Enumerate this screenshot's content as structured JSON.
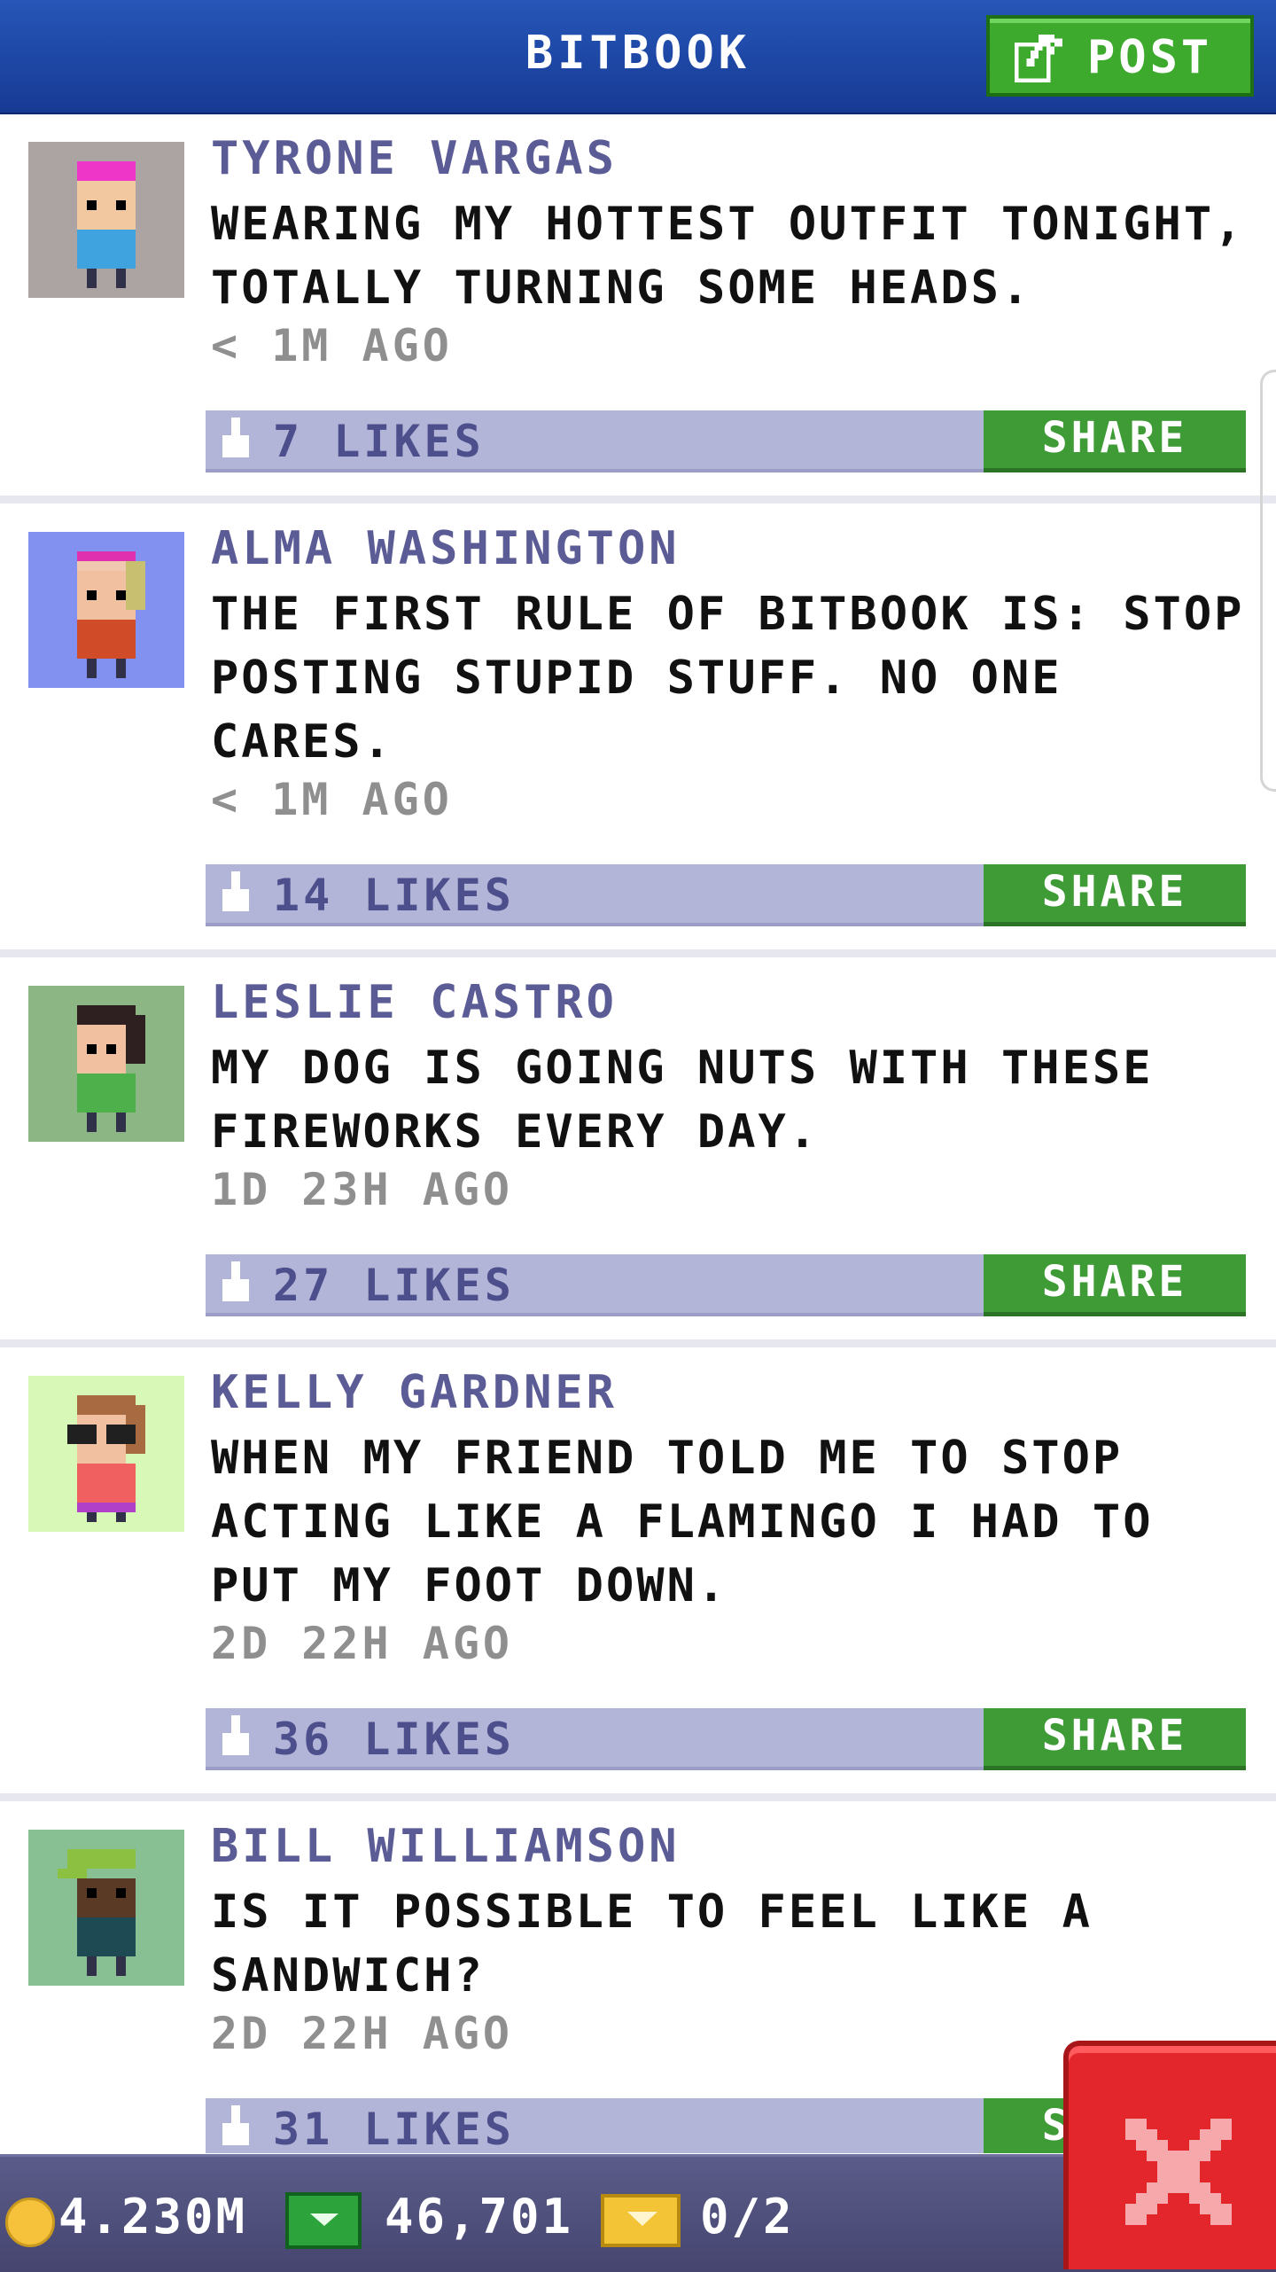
{
  "header": {
    "title": "BITBOOK",
    "post_label": "POST"
  },
  "posts": [
    {
      "author": "TYRONE VARGAS",
      "message": "WEARING MY HOTTEST OUTFIT TONIGHT, TOTALLY TURNING SOME HEADS.",
      "time": "< 1M AGO",
      "likes": "7 LIKES",
      "share": "SHARE"
    },
    {
      "author": "ALMA WASHINGTON",
      "message": "THE FIRST RULE OF BITBOOK IS: STOP POSTING STUPID STUFF. NO ONE CARES.",
      "time": "< 1M AGO",
      "likes": "14 LIKES",
      "share": "SHARE"
    },
    {
      "author": "LESLIE CASTRO",
      "message": "MY DOG IS GOING NUTS WITH THESE FIREWORKS EVERY DAY.",
      "time": "1D 23H AGO",
      "likes": "27 LIKES",
      "share": "SHARE"
    },
    {
      "author": "KELLY GARDNER",
      "message": "WHEN MY FRIEND TOLD ME TO STOP ACTING LIKE A FLAMINGO I HAD TO PUT MY FOOT DOWN.",
      "time": "2D 22H AGO",
      "likes": "36 LIKES",
      "share": "SHARE"
    },
    {
      "author": "BILL WILLIAMSON",
      "message": "IS IT POSSIBLE TO FEEL LIKE A SANDWICH?",
      "time": "2D 22H AGO",
      "likes": "31 LIKES",
      "share": "SHARE"
    }
  ],
  "status": {
    "coins": "4.230M",
    "cash": "46,701",
    "tickets": "0/2"
  },
  "icons": {
    "post": "edit-icon",
    "like": "thumbs-up-icon",
    "coin": "coin-icon",
    "cash": "cash-icon",
    "ticket": "ticket-icon",
    "close": "close-icon"
  },
  "colors": {
    "header": "#1f4aa8",
    "post_button": "#3daa2e",
    "likes_bar": "#b3b5d8",
    "share_button": "#3e9b36",
    "author": "#5b5b96",
    "close_button": "#e2262c",
    "bottom_bar": "#52527e"
  }
}
